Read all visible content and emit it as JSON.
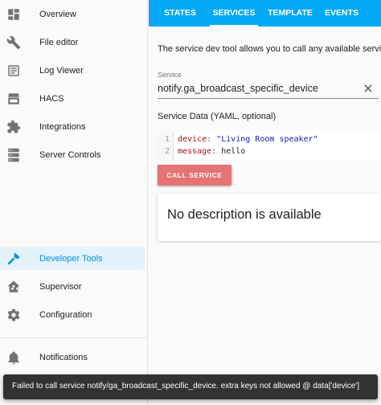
{
  "sidebar": {
    "items": [
      {
        "label": "Overview",
        "icon": "view-dashboard-icon"
      },
      {
        "label": "File editor",
        "icon": "wrench-icon"
      },
      {
        "label": "Log Viewer",
        "icon": "text-box-icon"
      },
      {
        "label": "HACS",
        "icon": "hacs-store-icon"
      },
      {
        "label": "Integrations",
        "icon": "puzzle-icon"
      },
      {
        "label": "Server Controls",
        "icon": "server-icon"
      }
    ],
    "bottom_items": [
      {
        "label": "Developer Tools",
        "icon": "hammer-icon",
        "active": true
      },
      {
        "label": "Supervisor",
        "icon": "home-assistant-icon"
      },
      {
        "label": "Configuration",
        "icon": "cog-icon"
      }
    ],
    "notifications": {
      "label": "Notifications",
      "icon": "bell-icon"
    },
    "active_color": "#0391d4"
  },
  "header": {
    "tabs": [
      {
        "label": "STATES"
      },
      {
        "label": "SERVICES",
        "active": true
      },
      {
        "label": "TEMPLATE"
      },
      {
        "label": "EVENTS"
      }
    ],
    "color": "#03a9f4"
  },
  "main": {
    "intro": "The service dev tool allows you to call any available service in",
    "service_field": {
      "label": "Service",
      "value": "notify.ga_broadcast_specific_device"
    },
    "service_data_label": "Service Data (YAML, optional)",
    "code": {
      "line_numbers": [
        "1",
        "2"
      ],
      "line1": {
        "key": "device",
        "sep": ": ",
        "value": "\"Living Room speaker\""
      },
      "line2": {
        "key": "message",
        "sep": ": ",
        "value": "hello"
      }
    },
    "call_button_label": "CALL SERVICE",
    "call_button_color": "#e57373",
    "description": "No description is available"
  },
  "snackbar": {
    "message": "Failed to call service notify/ga_broadcast_specific_device. extra keys not allowed @ data['device']"
  }
}
